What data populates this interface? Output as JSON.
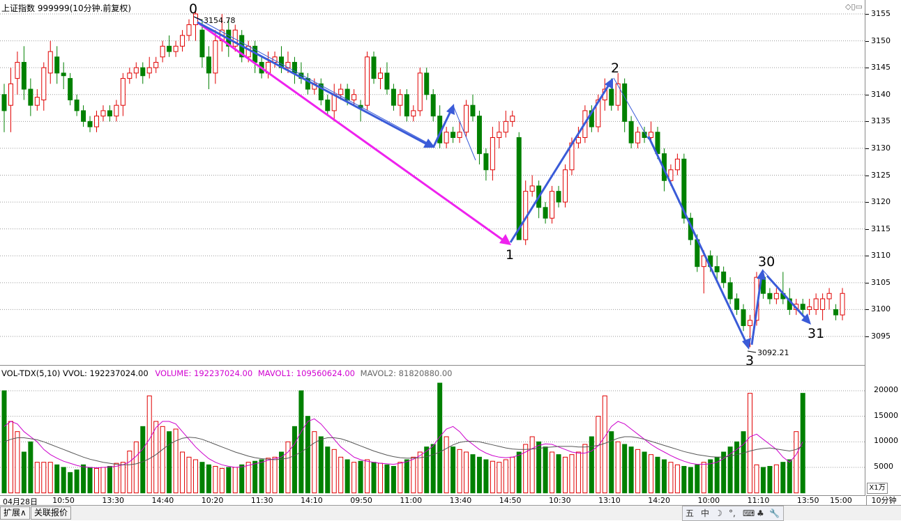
{
  "header": {
    "title": "上证指数 999999(10分钟.前复权)"
  },
  "indicator": {
    "name": "VOL-TDX(5,10)",
    "vvol": "VVOL: 192237024.00",
    "volume": "VOLUME: 192237024.00",
    "mavol1": "MAVOL1: 109560624.00",
    "mavol2": "MAVOL2: 81820880.00"
  },
  "annotations": {
    "wave0": "0",
    "wave1": "1",
    "wave2": "2",
    "wave3": "3",
    "wave30": "30",
    "wave31": "31",
    "high_label": "3154.78",
    "low_label": "3092.21"
  },
  "price_axis": [
    "3155",
    "3150",
    "3145",
    "3140",
    "3135",
    "3130",
    "3125",
    "3120",
    "3115",
    "3110",
    "3105",
    "3100",
    "3095"
  ],
  "volume_axis": [
    "20000",
    "15000",
    "10000",
    "5000"
  ],
  "scale_label": "X1万",
  "time_axis": [
    "04月28日",
    "10:50",
    "13:30",
    "14:40",
    "10:20",
    "11:30",
    "14:10",
    "09:50",
    "11:00",
    "13:40",
    "14:50",
    "10:30",
    "13:10",
    "14:20",
    "10:00",
    "11:10",
    "13:50",
    "15:00"
  ],
  "period_label": "10分钟",
  "tabs": [
    "扩展∧",
    "关联报价"
  ],
  "ime_toolbar": [
    "五",
    "中",
    "☽",
    "°,",
    "⌨",
    "♣",
    "🔧"
  ],
  "colors": {
    "up": "#e00000",
    "down": "#008000",
    "arrow_blue": "#3a5bd8",
    "arrow_magenta": "#ee22ee",
    "ma1": "#cc00cc",
    "ma2": "#555555"
  },
  "chart_data": {
    "type": "candlestick",
    "ylim": [
      3090,
      3157
    ],
    "volume_ylim": [
      0,
      22000
    ],
    "candles": [
      [
        3140,
        3137,
        3142,
        3133
      ],
      [
        3138,
        3142,
        3145,
        3133
      ],
      [
        3143,
        3146,
        3148,
        3140
      ],
      [
        3146,
        3141,
        3149,
        3139
      ],
      [
        3141,
        3138,
        3143,
        3136
      ],
      [
        3138,
        3139.5,
        3141,
        3137
      ],
      [
        3139,
        3145,
        3146,
        3137
      ],
      [
        3144,
        3148,
        3150,
        3142
      ],
      [
        3147,
        3144,
        3149,
        3142
      ],
      [
        3144,
        3143.5,
        3146,
        3141
      ],
      [
        3143,
        3139,
        3144,
        3138
      ],
      [
        3139,
        3137,
        3140,
        3136
      ],
      [
        3137,
        3135,
        3138,
        3134
      ],
      [
        3135,
        3134,
        3136,
        3133
      ],
      [
        3134,
        3136,
        3137,
        3133
      ],
      [
        3136,
        3137,
        3138,
        3135
      ],
      [
        3137,
        3136,
        3138,
        3135
      ],
      [
        3136,
        3138,
        3139,
        3135
      ],
      [
        3138,
        3143,
        3144,
        3136
      ],
      [
        3143,
        3144,
        3145,
        3142
      ],
      [
        3144,
        3145,
        3146,
        3143
      ],
      [
        3145,
        3143.5,
        3146,
        3142
      ],
      [
        3144,
        3145,
        3147,
        3143
      ],
      [
        3145,
        3146,
        3147,
        3144
      ],
      [
        3147,
        3149,
        3150,
        3146
      ],
      [
        3149,
        3148,
        3151,
        3147
      ],
      [
        3148,
        3149,
        3150,
        3147
      ],
      [
        3149,
        3151,
        3152,
        3148
      ],
      [
        3151,
        3153,
        3154,
        3150
      ],
      [
        3153,
        3155,
        3156,
        3150
      ],
      [
        3152,
        3147,
        3154,
        3145
      ],
      [
        3147,
        3144,
        3149,
        3141
      ],
      [
        3144,
        3150,
        3152,
        3142
      ],
      [
        3150,
        3152,
        3155,
        3148
      ],
      [
        3152,
        3149,
        3154,
        3147
      ],
      [
        3149,
        3152,
        3153,
        3148
      ],
      [
        3151,
        3147,
        3152,
        3146
      ],
      [
        3147,
        3149,
        3150,
        3146
      ],
      [
        3149,
        3146,
        3150,
        3144
      ],
      [
        3146,
        3144,
        3147,
        3143
      ],
      [
        3144,
        3146,
        3148,
        3143
      ],
      [
        3146,
        3147,
        3148,
        3145
      ],
      [
        3147,
        3145,
        3149,
        3144
      ],
      [
        3145,
        3146,
        3148,
        3144
      ],
      [
        3146,
        3144,
        3147,
        3142
      ],
      [
        3144,
        3143,
        3146,
        3142
      ],
      [
        3143,
        3141,
        3144,
        3140
      ],
      [
        3141,
        3142,
        3143,
        3140
      ],
      [
        3142,
        3139,
        3143,
        3138
      ],
      [
        3139,
        3137,
        3140,
        3136
      ],
      [
        3137,
        3140,
        3142,
        3135
      ],
      [
        3140,
        3141,
        3142,
        3139
      ],
      [
        3141,
        3139,
        3142,
        3138
      ],
      [
        3139,
        3140,
        3141,
        3138
      ],
      [
        3138,
        3137.5,
        3139,
        3135
      ],
      [
        3138,
        3147,
        3148,
        3137
      ],
      [
        3147,
        3143,
        3148,
        3142
      ],
      [
        3143,
        3144,
        3145,
        3141
      ],
      [
        3144,
        3141,
        3146,
        3140
      ],
      [
        3141,
        3138,
        3142,
        3137
      ],
      [
        3138,
        3140,
        3141,
        3136
      ],
      [
        3140,
        3136,
        3141,
        3135
      ],
      [
        3136,
        3137,
        3138,
        3135
      ],
      [
        3137,
        3144,
        3145,
        3136
      ],
      [
        3144,
        3140,
        3145,
        3139
      ],
      [
        3140,
        3136,
        3141,
        3135
      ],
      [
        3136,
        3131,
        3138,
        3130
      ],
      [
        3131,
        3133,
        3134,
        3130
      ],
      [
        3133,
        3132,
        3134,
        3131
      ],
      [
        3132,
        3133,
        3135,
        3131
      ],
      [
        3133,
        3138,
        3139,
        3132
      ],
      [
        3138,
        3136,
        3140,
        3135
      ],
      [
        3136,
        3129,
        3137,
        3127
      ],
      [
        3129,
        3126,
        3130,
        3124
      ],
      [
        3126,
        3132,
        3134,
        3124
      ],
      [
        3132,
        3133,
        3135,
        3130
      ],
      [
        3133,
        3135,
        3137,
        3132
      ],
      [
        3135,
        3136,
        3137,
        3134
      ],
      [
        3132,
        3113,
        3133,
        3113
      ],
      [
        3113,
        3122,
        3124,
        3112
      ],
      [
        3122,
        3123,
        3125,
        3121
      ],
      [
        3123,
        3119,
        3124,
        3117
      ],
      [
        3119,
        3117,
        3120,
        3116
      ],
      [
        3117,
        3122,
        3123,
        3116
      ],
      [
        3122,
        3120,
        3123,
        3119
      ],
      [
        3120,
        3126,
        3127,
        3119
      ],
      [
        3126,
        3131,
        3132,
        3125
      ],
      [
        3131,
        3132,
        3134,
        3130
      ],
      [
        3132,
        3137,
        3138,
        3131
      ],
      [
        3137,
        3134,
        3138,
        3133
      ],
      [
        3134,
        3139,
        3140,
        3133
      ],
      [
        3139,
        3141,
        3143,
        3137
      ],
      [
        3141,
        3138,
        3143,
        3137
      ],
      [
        3138,
        3142,
        3144,
        3137
      ],
      [
        3142,
        3135,
        3143,
        3133
      ],
      [
        3135,
        3131,
        3136,
        3130
      ],
      [
        3131,
        3133,
        3134,
        3130
      ],
      [
        3133,
        3132,
        3134,
        3131
      ],
      [
        3132,
        3133,
        3135,
        3131
      ],
      [
        3133,
        3129,
        3134,
        3128
      ],
      [
        3129,
        3124,
        3130,
        3122
      ],
      [
        3124,
        3126,
        3127,
        3123
      ],
      [
        3126,
        3128,
        3129,
        3125
      ],
      [
        3128,
        3117,
        3129,
        3116
      ],
      [
        3117,
        3113,
        3118,
        3112
      ],
      [
        3113,
        3108,
        3114,
        3107
      ],
      [
        3108,
        3110,
        3111,
        3103
      ],
      [
        3110,
        3108,
        3111,
        3107
      ],
      [
        3108,
        3107,
        3110,
        3105
      ],
      [
        3107,
        3105,
        3108,
        3104
      ],
      [
        3105,
        3102,
        3106,
        3101
      ],
      [
        3102,
        3100,
        3103,
        3099
      ],
      [
        3100,
        3097,
        3101,
        3096
      ],
      [
        3097,
        3098,
        3099,
        3093
      ],
      [
        3098,
        3106,
        3107,
        3097
      ],
      [
        3106,
        3103,
        3107,
        3102
      ],
      [
        3103,
        3102,
        3104,
        3101
      ],
      [
        3102,
        3103,
        3104,
        3101
      ],
      [
        3103,
        3102,
        3107,
        3101
      ],
      [
        3102,
        3100,
        3104,
        3099
      ],
      [
        3100,
        3101,
        3102,
        3099
      ],
      [
        3101,
        3100,
        3102,
        3099
      ],
      [
        3100,
        3100.5,
        3102,
        3099
      ],
      [
        3100,
        3102,
        3103,
        3099
      ],
      [
        3100,
        3102,
        3103,
        3098
      ],
      [
        3102,
        3103,
        3104,
        3100
      ],
      [
        3100,
        3099,
        3101,
        3098
      ],
      [
        3099,
        3103,
        3104,
        3098
      ]
    ],
    "volumes": [
      20000,
      14000,
      12000,
      8000,
      10000,
      6000,
      6000,
      6000,
      5500,
      5000,
      4000,
      4500,
      5500,
      5000,
      4800,
      5000,
      5200,
      5800,
      6000,
      8200,
      10000,
      13000,
      19000,
      14000,
      13000,
      12000,
      12500,
      8000,
      7000,
      6500,
      6000,
      5500,
      5200,
      4800,
      5000,
      5000,
      5500,
      6000,
      6200,
      6500,
      6800,
      7000,
      8000,
      10000,
      13000,
      20000,
      15000,
      12000,
      11000,
      9000,
      8500,
      7000,
      6500,
      6000,
      6200,
      6500,
      6000,
      5800,
      5500,
      5200,
      6000,
      6500,
      7000,
      8000,
      9000,
      9500,
      21500,
      11000,
      9000,
      8500,
      8000,
      7500,
      7000,
      6500,
      6200,
      6000,
      6500,
      7000,
      8000,
      9500,
      11000,
      10000,
      9000,
      8000,
      7500,
      7000,
      7500,
      8000,
      9500,
      11000,
      15000,
      19000,
      12000,
      10000,
      9500,
      9000,
      8500,
      8000,
      7500,
      7000,
      6500,
      6000,
      5500,
      5200,
      5000,
      5500,
      6000,
      6500,
      7000,
      8000,
      9000,
      10000,
      12000,
      19500,
      5500,
      5000,
      5200,
      5500,
      6000,
      6500,
      12000,
      19500
    ],
    "mavol1": [
      13000,
      14000,
      13500,
      12000,
      11000,
      10000,
      8500,
      7500,
      6800,
      6200,
      5800,
      5400,
      5100,
      5000,
      4900,
      5000,
      5100,
      5200,
      5500,
      6100,
      7200,
      8600,
      10500,
      12800,
      14000,
      14000,
      13500,
      12000,
      10500,
      9000,
      7800,
      6700,
      6000,
      5500,
      5200,
      5000,
      5100,
      5400,
      5700,
      6000,
      6400,
      6700,
      7000,
      8000,
      9600,
      12000,
      14000,
      14500,
      13500,
      12000,
      10500,
      9000,
      8000,
      7000,
      6500,
      6200,
      6000,
      5800,
      5700,
      5600,
      5800,
      6100,
      6600,
      7300,
      8200,
      9200,
      11000,
      12500,
      13000,
      12000,
      10500,
      9500,
      8500,
      7800,
      7300,
      7000,
      6900,
      7000,
      7400,
      8000,
      8700,
      9300,
      9600,
      9500,
      9000,
      8500,
      8000,
      7800,
      7800,
      8200,
      9200,
      11000,
      13000,
      14000,
      13500,
      12500,
      11500,
      10500,
      9500,
      8700,
      8000,
      7300,
      6700,
      6200,
      5800,
      5600,
      5600,
      5700,
      6000,
      6700,
      7600,
      8500,
      9500,
      11000,
      11500,
      10500,
      9500,
      8500,
      7000,
      6000,
      7500,
      10000
    ],
    "mavol2": [
      10000,
      10500,
      10800,
      10800,
      10600,
      10400,
      10000,
      9500,
      9000,
      8500,
      8000,
      7500,
      7000,
      6600,
      6300,
      6000,
      5800,
      5600,
      5500,
      5500,
      5700,
      6100,
      6700,
      7500,
      8500,
      9500,
      10200,
      10700,
      10900,
      10800,
      10500,
      10000,
      9500,
      9000,
      8500,
      8000,
      7600,
      7200,
      6900,
      6700,
      6600,
      6500,
      6600,
      6800,
      7300,
      8000,
      8900,
      9800,
      10500,
      10800,
      10800,
      10600,
      10200,
      9700,
      9200,
      8700,
      8200,
      7800,
      7400,
      7100,
      6900,
      6800,
      6800,
      6900,
      7100,
      7500,
      8000,
      8700,
      9400,
      9900,
      10100,
      10100,
      10000,
      9700,
      9400,
      9100,
      8800,
      8600,
      8500,
      8500,
      8600,
      8700,
      8900,
      9000,
      9100,
      9100,
      9100,
      9000,
      9000,
      9100,
      9300,
      9700,
      10200,
      10700,
      11000,
      11000,
      10800,
      10500,
      10100,
      9700,
      9300,
      8900,
      8500,
      8100,
      7800,
      7500,
      7300,
      7100,
      7000,
      7000,
      7200,
      7500,
      7800,
      8200,
      8500,
      8700,
      8800,
      8600,
      8400,
      8200,
      8500,
      9200
    ]
  }
}
